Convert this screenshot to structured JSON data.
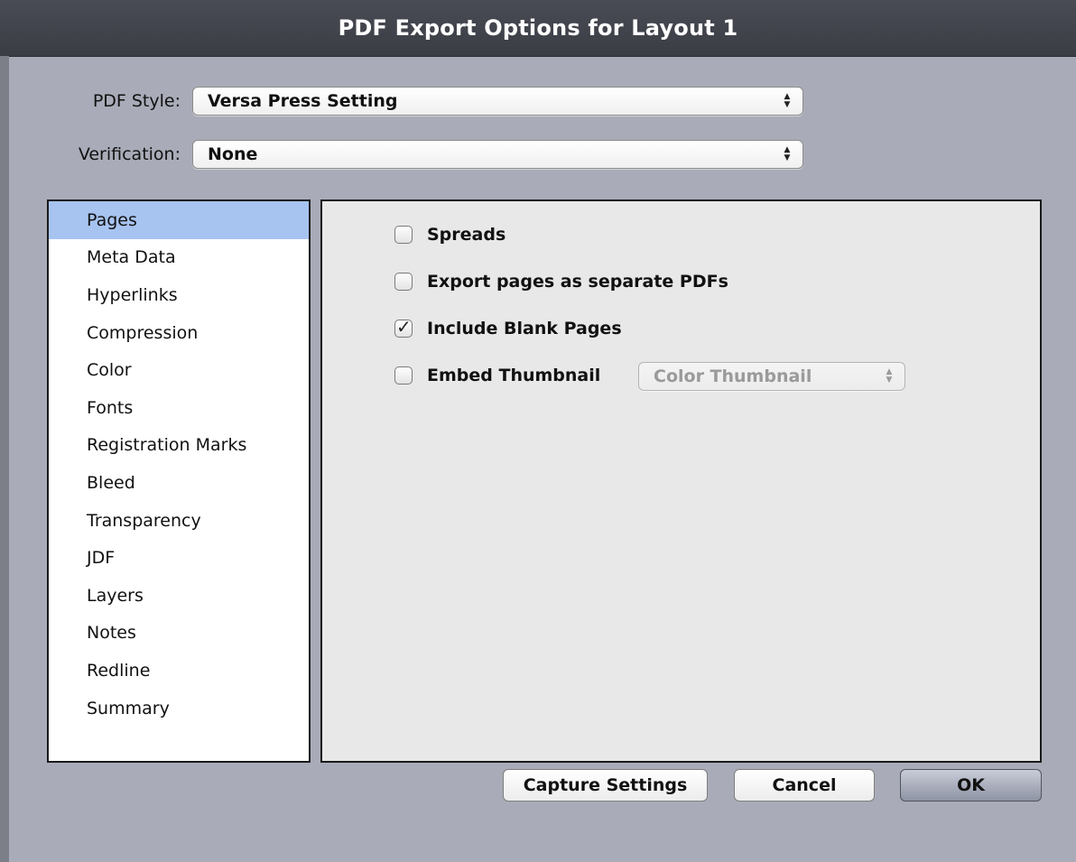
{
  "window": {
    "title": "PDF Export Options for Layout 1"
  },
  "pdf_style": {
    "label": "PDF Style:",
    "value": "Versa Press Setting"
  },
  "verification": {
    "label": "Verification:",
    "value": "None"
  },
  "sidebar": {
    "items": [
      {
        "label": "Pages",
        "selected": true
      },
      {
        "label": "Meta Data"
      },
      {
        "label": "Hyperlinks"
      },
      {
        "label": "Compression"
      },
      {
        "label": "Color"
      },
      {
        "label": "Fonts"
      },
      {
        "label": "Registration Marks"
      },
      {
        "label": "Bleed"
      },
      {
        "label": "Transparency"
      },
      {
        "label": "JDF"
      },
      {
        "label": "Layers"
      },
      {
        "label": "Notes"
      },
      {
        "label": "Redline"
      },
      {
        "label": "Summary"
      }
    ]
  },
  "pages_panel": {
    "spreads": {
      "label": "Spreads",
      "checked": false
    },
    "separate_pdfs": {
      "label": "Export pages as separate PDFs",
      "checked": false
    },
    "include_blank": {
      "label": "Include Blank Pages",
      "checked": true
    },
    "embed_thumbnail": {
      "label": "Embed Thumbnail",
      "checked": false,
      "option": "Color Thumbnail",
      "option_enabled": false
    }
  },
  "buttons": {
    "capture": "Capture Settings",
    "cancel": "Cancel",
    "ok": "OK"
  },
  "icons": {
    "popup_arrows": "up-down-arrows-icon",
    "checkmark": "checkmark-icon"
  },
  "colors": {
    "titlebar": "#3f4149",
    "background": "#a9acb8",
    "selection": "#a7c3f0",
    "panel": "#e8e8e8"
  }
}
